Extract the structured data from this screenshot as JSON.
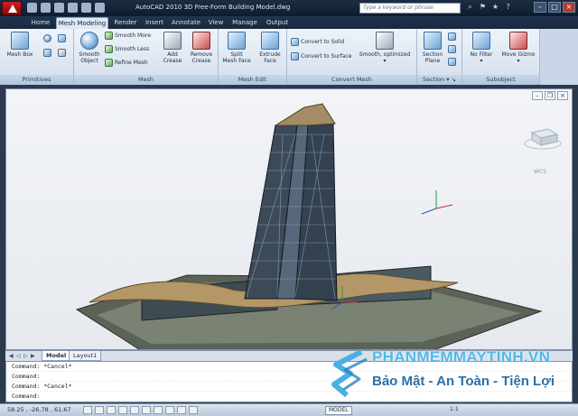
{
  "window": {
    "title": "AutoCAD 2010   3D Free-Form Building Model.dwg",
    "search_placeholder": "Type a keyword or phrase"
  },
  "tabs": [
    {
      "label": "Home",
      "active": false
    },
    {
      "label": "Mesh Modeling",
      "active": true
    },
    {
      "label": "Render",
      "active": false
    },
    {
      "label": "Insert",
      "active": false
    },
    {
      "label": "Annotate",
      "active": false
    },
    {
      "label": "View",
      "active": false
    },
    {
      "label": "Manage",
      "active": false
    },
    {
      "label": "Output",
      "active": false
    }
  ],
  "ribbon": {
    "primitives": {
      "title": "Primitives",
      "mesh_box": "Mesh Box"
    },
    "mesh": {
      "title": "Mesh",
      "smooth_object": [
        "Smooth",
        "Object"
      ],
      "smooth_more": "Smooth More",
      "smooth_less": "Smooth Less",
      "refine_mesh": "Refine Mesh",
      "add_crease": [
        "Add",
        "Crease"
      ],
      "remove_crease": [
        "Remove",
        "Crease"
      ]
    },
    "mesh_edit": {
      "title": "Mesh Edit",
      "split_mesh_face": [
        "Split",
        "Mesh Face"
      ],
      "extrude_face": [
        "Extrude",
        "Face"
      ]
    },
    "convert_mesh": {
      "title": "Convert Mesh",
      "convert_to_solid": "Convert to Solid",
      "convert_to_surface": "Convert to Surface",
      "smooth_optimized": "Smooth, optimized"
    },
    "section": {
      "title": "Section",
      "section_plane": [
        "Section",
        "Plane"
      ]
    },
    "subobject": {
      "title": "Subobject",
      "no_filter": "No Filter",
      "move_gizmo": "Move Gizmo"
    }
  },
  "viewport": {
    "wcs_label": "WCS"
  },
  "layout_tabs": [
    "Model",
    "Layout1"
  ],
  "command_lines": [
    "Command: *Cancel*",
    "Command:",
    "Command: *Cancel*",
    "Command:"
  ],
  "status": {
    "coords": "58.25 , -26.78 , 61.67",
    "model_button": "MODEL",
    "scale": "1:1"
  },
  "watermark": {
    "name": "PHANMEMMAYTINH.VN",
    "slogan": "Bảo Mật - An Toàn - Tiện Lợi"
  },
  "colors": {
    "title_bar": "#0f1c2e",
    "ribbon": "#d3deec",
    "viewport_bg": "#eceff3",
    "watermark_blue": "#53b8e8"
  }
}
